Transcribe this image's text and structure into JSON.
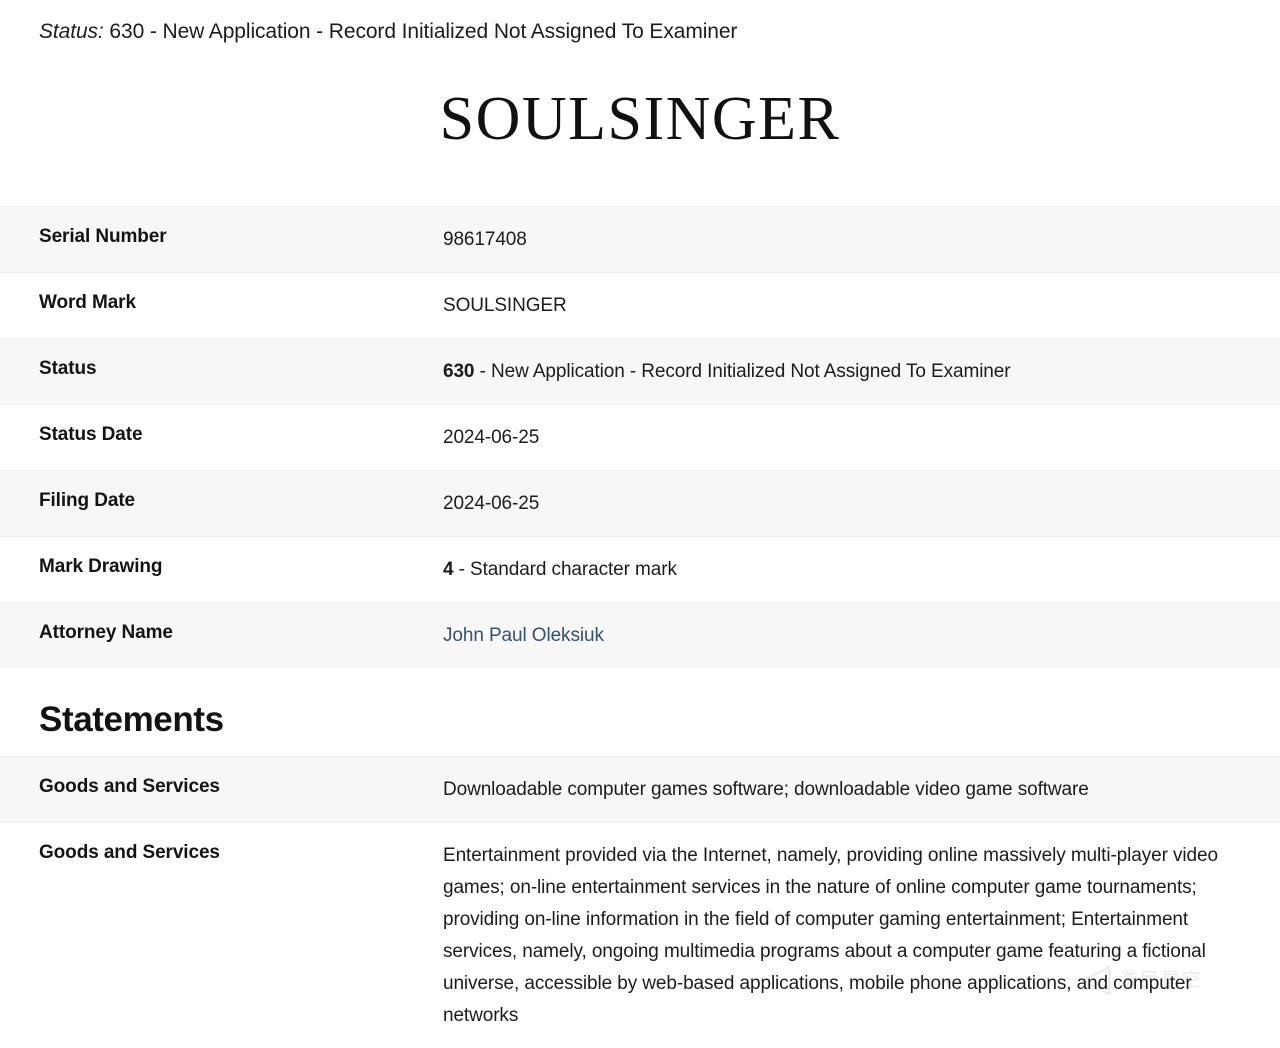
{
  "header": {
    "status_label": "Status:",
    "status_value": "630 - New Application - Record Initialized Not Assigned To Examiner"
  },
  "mark": {
    "logo_text": "SOULSINGER"
  },
  "details": {
    "rows": [
      {
        "label": "Serial Number",
        "value": "98617408",
        "bold_prefix": ""
      },
      {
        "label": "Word Mark",
        "value": "SOULSINGER",
        "bold_prefix": ""
      },
      {
        "label": "Status",
        "value": " - New Application - Record Initialized Not Assigned To Examiner",
        "bold_prefix": "630"
      },
      {
        "label": "Status Date",
        "value": "2024-06-25",
        "bold_prefix": ""
      },
      {
        "label": "Filing Date",
        "value": "2024-06-25",
        "bold_prefix": ""
      },
      {
        "label": "Mark Drawing",
        "value": " - Standard character mark",
        "bold_prefix": "4"
      },
      {
        "label": "Attorney Name",
        "value": "John Paul Oleksiuk",
        "bold_prefix": "",
        "is_link": true
      }
    ]
  },
  "statements": {
    "heading": "Statements",
    "rows": [
      {
        "label": "Goods and Services",
        "value": "Downloadable computer games software; downloadable video game software"
      },
      {
        "label": "Goods and Services",
        "value": "Entertainment provided via the Internet, namely, providing online massively multi-player video games; on-line entertainment services in the nature of online computer game tournaments; providing on-line information in the field of computer gaming entertainment; Entertainment services, namely, ongoing multimedia programs about a computer game featuring a fictional universe, accessible by web-based applications, mobile phone applications, and computer networks"
      }
    ]
  },
  "watermark": {
    "glyph": "◁",
    "text": "游民星空"
  },
  "colors": {
    "link": "#34516f",
    "row_shaded": "#f7f7f7",
    "text": "#1c1c1c"
  }
}
